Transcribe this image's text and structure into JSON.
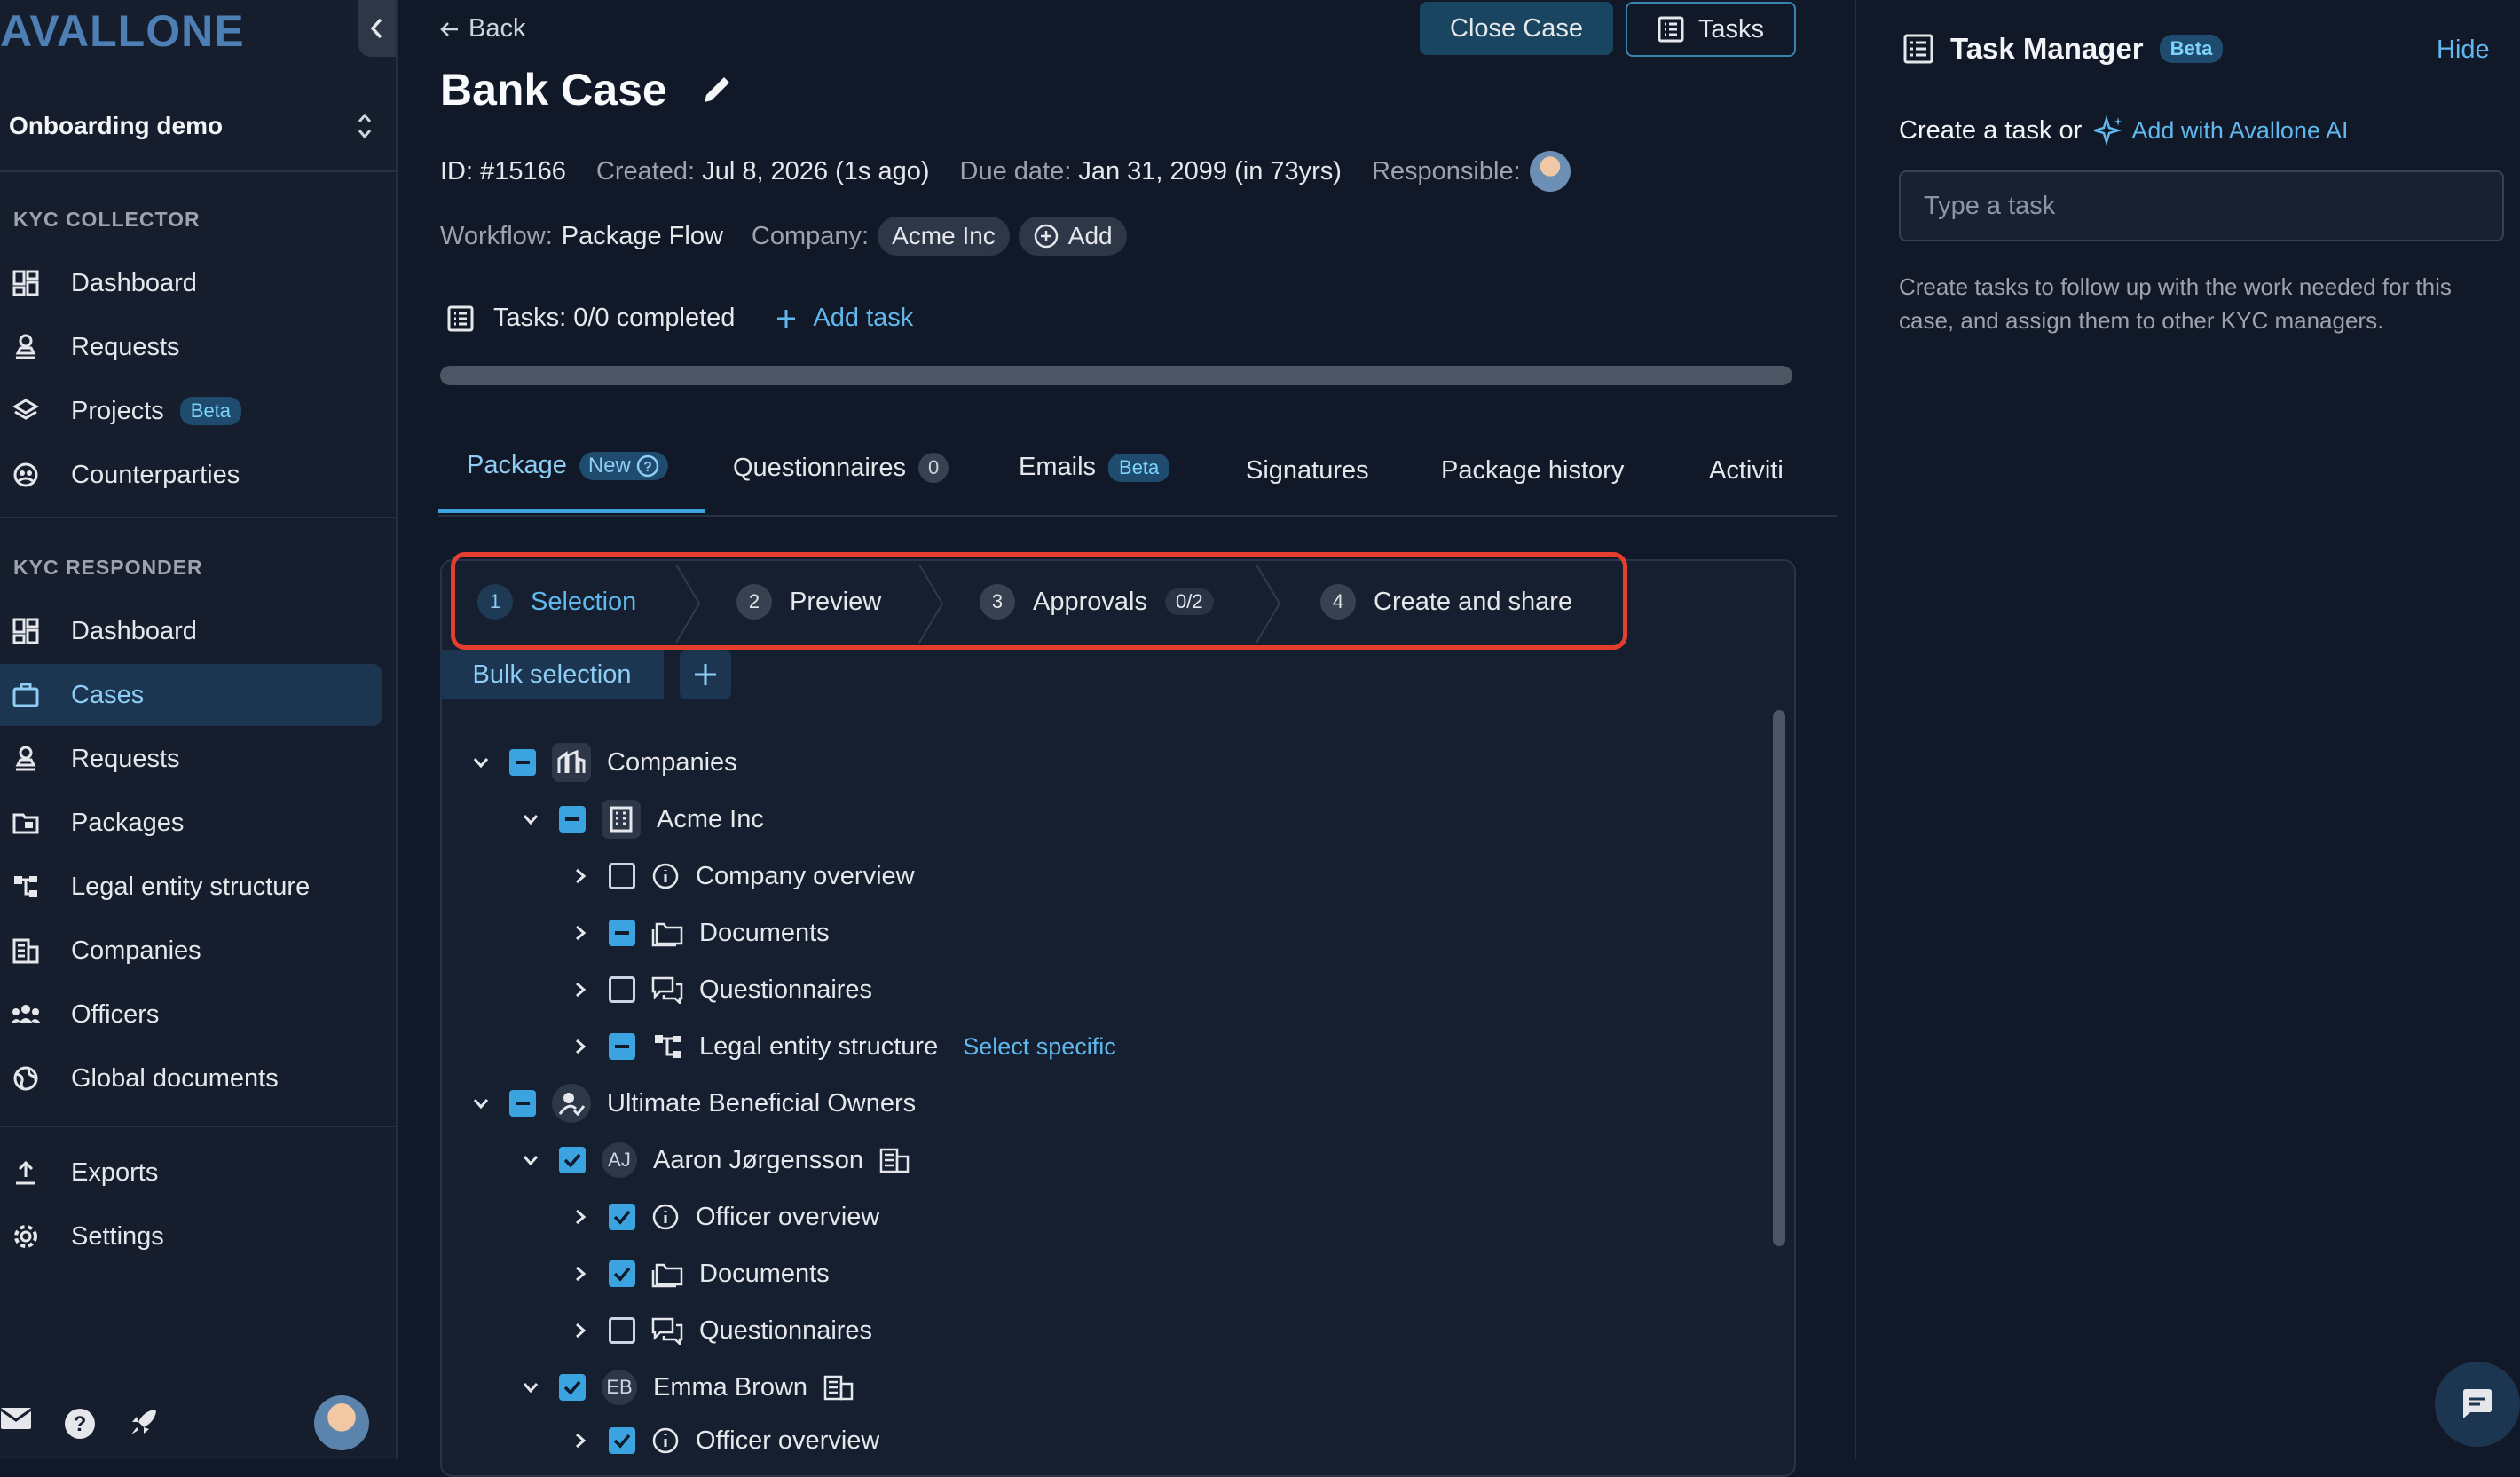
{
  "brand": {
    "logo_text": "AVALLONE"
  },
  "org": {
    "name": "Onboarding demo"
  },
  "sidebar": {
    "collector_label": "KYC COLLECTOR",
    "collector_items": [
      {
        "label": "Dashboard"
      },
      {
        "label": "Requests"
      },
      {
        "label": "Projects",
        "badge": "Beta"
      },
      {
        "label": "Counterparties"
      }
    ],
    "responder_label": "KYC RESPONDER",
    "responder_items": [
      {
        "label": "Dashboard"
      },
      {
        "label": "Cases",
        "active": true
      },
      {
        "label": "Requests"
      },
      {
        "label": "Packages"
      },
      {
        "label": "Legal entity structure"
      },
      {
        "label": "Companies"
      },
      {
        "label": "Officers"
      },
      {
        "label": "Global documents"
      }
    ],
    "bottom_items": [
      {
        "label": "Exports"
      },
      {
        "label": "Settings"
      }
    ]
  },
  "header": {
    "back": "Back",
    "close_case": "Close Case",
    "tasks": "Tasks",
    "title": "Bank Case"
  },
  "meta": {
    "id": "ID: #15166",
    "created_label": "Created:",
    "created_value": "Jul 8, 2026 (1s ago)",
    "due_label": "Due date:",
    "due_value": "Jan 31, 2099 (in 73yrs)",
    "responsible_label": "Responsible:",
    "workflow_label": "Workflow:",
    "workflow_value": "Package Flow",
    "company_label": "Company:",
    "company_value": "Acme Inc",
    "add": "Add"
  },
  "tasks_row": {
    "label": "Tasks: 0/0 completed",
    "add": "Add task",
    "progress": 0
  },
  "tabs": [
    {
      "label": "Package",
      "badge": "New",
      "active": true
    },
    {
      "label": "Questionnaires",
      "count": "0"
    },
    {
      "label": "Emails",
      "badge": "Beta"
    },
    {
      "label": "Signatures"
    },
    {
      "label": "Package history"
    },
    {
      "label": "Activiti"
    }
  ],
  "steps": [
    {
      "num": "1",
      "label": "Selection",
      "active": true
    },
    {
      "num": "2",
      "label": "Preview"
    },
    {
      "num": "3",
      "label": "Approvals",
      "count": "0/2"
    },
    {
      "num": "4",
      "label": "Create and share"
    }
  ],
  "bulk": {
    "label": "Bulk selection"
  },
  "tree": [
    {
      "label": "Companies",
      "state": "partial",
      "icon": "companies-icon"
    },
    {
      "label": "Acme Inc",
      "state": "partial",
      "icon": "building-icon"
    },
    {
      "label": "Company overview",
      "state": "empty",
      "icon": "info-icon"
    },
    {
      "label": "Documents",
      "state": "partial",
      "icon": "folder-icon"
    },
    {
      "label": "Questionnaires",
      "state": "empty",
      "icon": "chat-icon"
    },
    {
      "label": "Legal entity structure",
      "state": "partial",
      "icon": "structure-icon",
      "link": "Select specific"
    },
    {
      "label": "Ultimate Beneficial Owners",
      "state": "partial",
      "icon": "person-check-icon"
    },
    {
      "label": "Aaron Jørgensson",
      "state": "checked",
      "initials": "AJ"
    },
    {
      "label": "Officer overview",
      "state": "checked",
      "icon": "info-icon"
    },
    {
      "label": "Documents",
      "state": "checked",
      "icon": "folder-icon"
    },
    {
      "label": "Questionnaires",
      "state": "empty",
      "icon": "chat-icon"
    },
    {
      "label": "Emma Brown",
      "state": "checked",
      "initials": "EB"
    },
    {
      "label": "Officer overview",
      "state": "checked",
      "icon": "info-icon"
    }
  ],
  "task_manager": {
    "title": "Task Manager",
    "badge": "Beta",
    "hide": "Hide",
    "create_prefix": "Create a task or",
    "ai_link": "Add with Avallone AI",
    "input_placeholder": "Type a task",
    "help": "Create tasks to follow up with the work needed for this case, and assign them to other KYC managers."
  },
  "colors": {
    "accent": "#3ba4e0",
    "highlight": "#e53e2e",
    "background": "#111827"
  }
}
